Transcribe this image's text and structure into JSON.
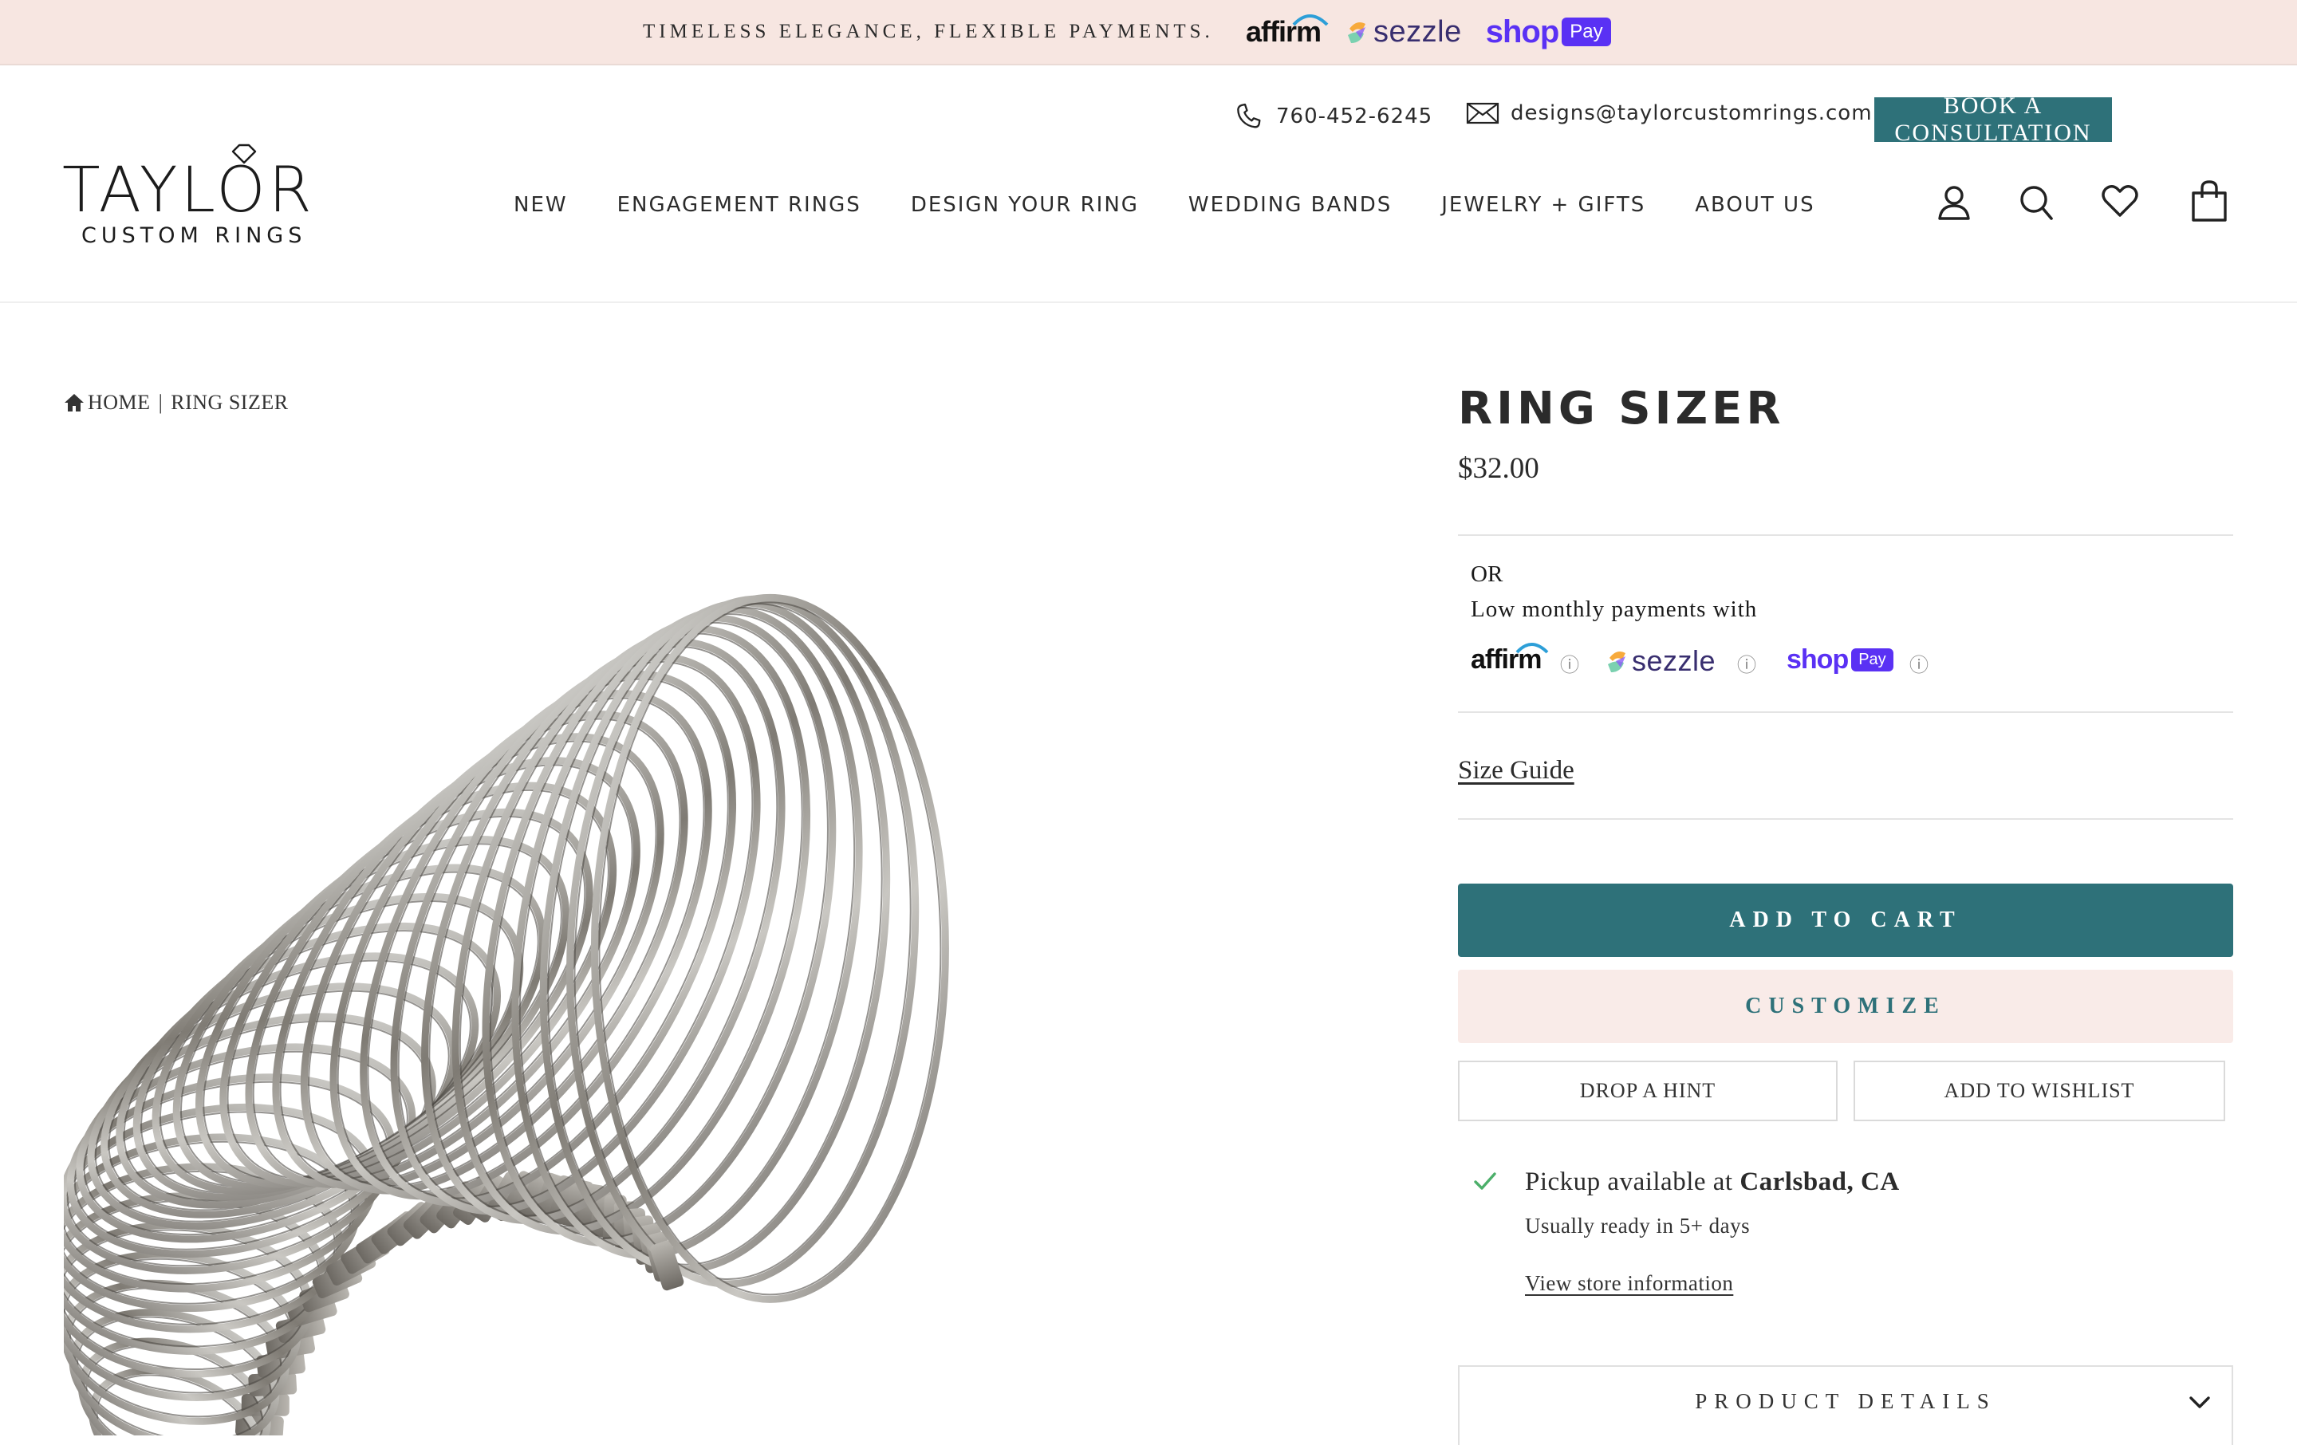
{
  "announcement": {
    "text": "TIMELESS ELEGANCE, FLEXIBLE PAYMENTS.",
    "providers": {
      "affirm": "affirm",
      "sezzle": "sezzle",
      "shop": "shop",
      "pay": "Pay"
    }
  },
  "header": {
    "phone": "760-452-6245",
    "email": "designs@taylorcustomrings.com",
    "consult_label": "BOOK A CONSULTATION",
    "brand": {
      "name": "TAYLOR",
      "sub": "CUSTOM RINGS"
    },
    "nav": [
      "NEW",
      "ENGAGEMENT RINGS",
      "DESIGN YOUR RING",
      "WEDDING BANDS",
      "JEWELRY + GIFTS",
      "ABOUT US"
    ],
    "icons": [
      "account-icon",
      "search-icon",
      "heart-icon",
      "cart-icon"
    ]
  },
  "breadcrumb": {
    "home": "HOME",
    "separator": "|",
    "current": "RING SIZER"
  },
  "product": {
    "title": "RING SIZER",
    "price": "$32.00",
    "or": "OR",
    "low_monthly": "Low monthly payments with",
    "payments": {
      "affirm": "affirm",
      "sezzle": "sezzle",
      "shop": "shop",
      "pay": "Pay",
      "info": "ⓘ"
    },
    "size_guide": "Size Guide",
    "add_to_cart": "ADD TO CART",
    "customize": "CUSTOMIZE",
    "drop_hint": "DROP A HINT",
    "add_wishlist": "ADD TO WISHLIST",
    "pickup_prefix": "Pickup available at ",
    "pickup_location": "Carlsbad, CA",
    "ready": "Usually ready in 5+ days",
    "store_info": "View store information",
    "details": "PRODUCT DETAILS"
  },
  "colors": {
    "accent": "#2e7179",
    "banner": "#f7e6e1",
    "customize_bg": "#f9ebe8",
    "check": "#4caf6a",
    "shop_purple": "#5a31f4"
  }
}
